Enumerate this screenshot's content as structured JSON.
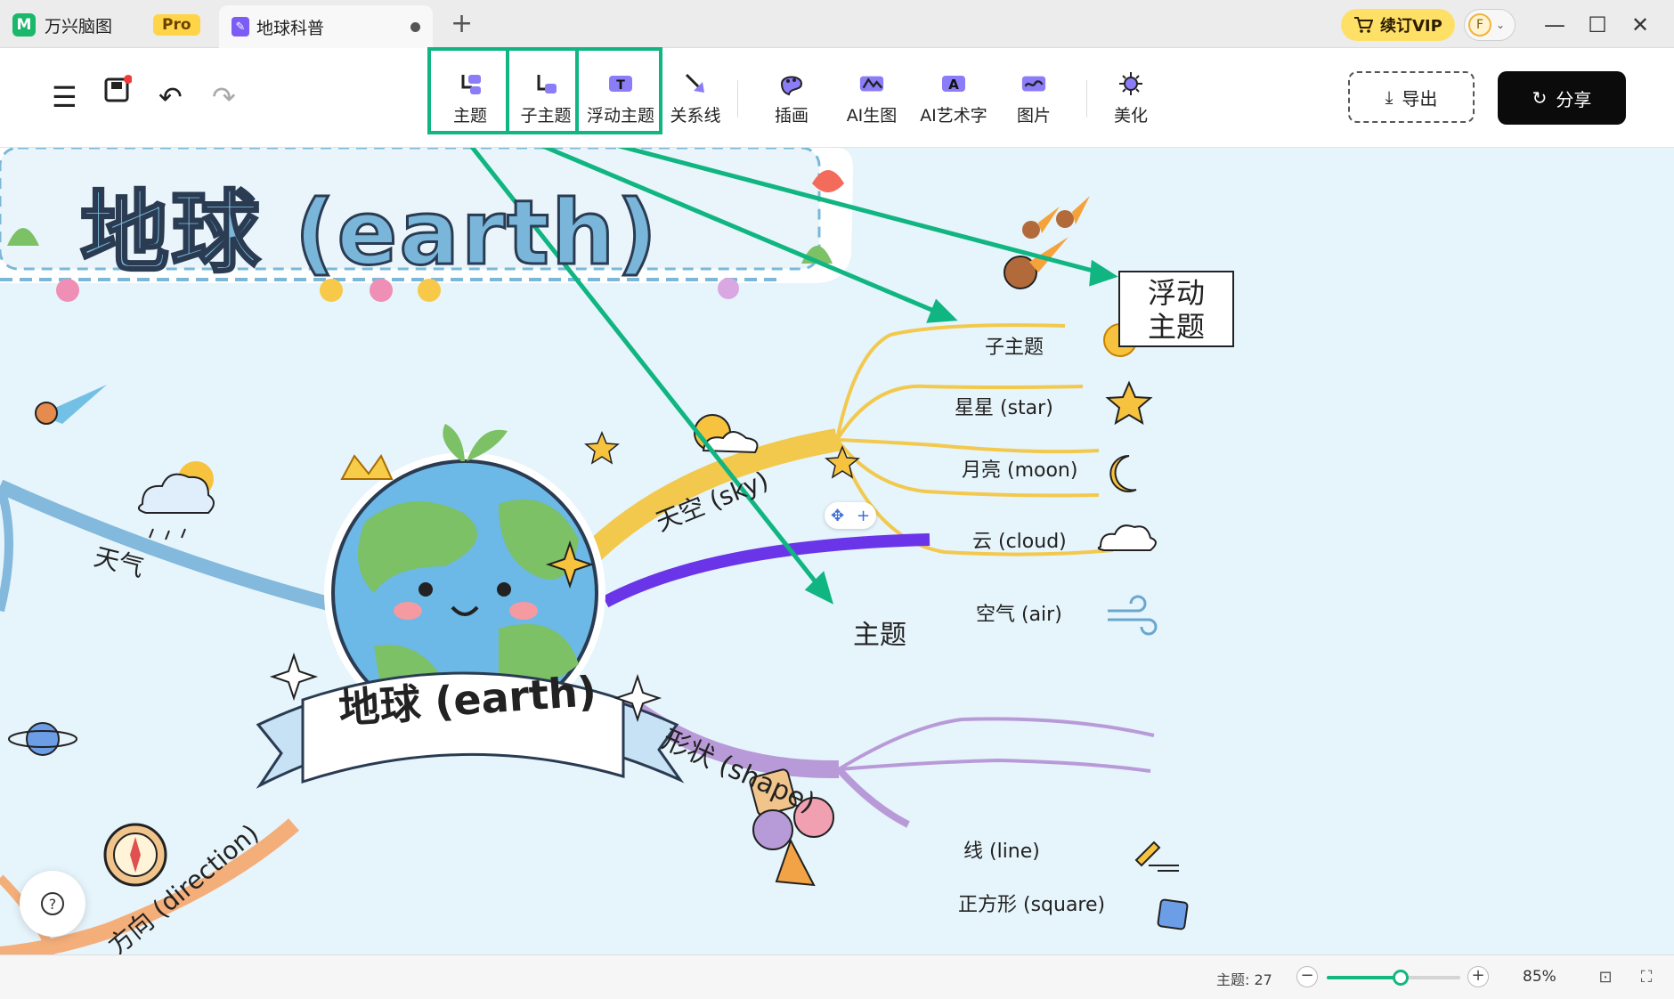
{
  "titlebar": {
    "app_name": "万兴脑图",
    "pro_badge": "Pro",
    "doc_tab": "地球科普",
    "vip_label": "续订VIP",
    "avatar_letter": "F",
    "new_tab": "+",
    "minimize": "—",
    "maximize": "☐",
    "close": "✕"
  },
  "toolbar": {
    "tools": [
      {
        "label": "主题",
        "icon": "topic-icon"
      },
      {
        "label": "子主题",
        "icon": "subtopic-icon"
      },
      {
        "label": "浮动主题",
        "icon": "floating-topic-icon"
      },
      {
        "label": "关系线",
        "icon": "relation-line-icon"
      },
      {
        "label": "插画",
        "icon": "illustration-icon"
      },
      {
        "label": "AI生图",
        "icon": "ai-image-icon"
      },
      {
        "label": "AI艺术字",
        "icon": "ai-art-text-icon"
      },
      {
        "label": "图片",
        "icon": "image-icon"
      },
      {
        "label": "美化",
        "icon": "beautify-icon"
      }
    ],
    "export_label": "导出",
    "share_label": "分享"
  },
  "canvas": {
    "banner_title": "地球 (earth)",
    "central_label": "地球 (earth)",
    "branches": {
      "sky": "天空 (sky)",
      "weather": "天气",
      "direction": "方向 (direction)",
      "shape": "形状 (shape)",
      "topic": "主题"
    },
    "sky_children": [
      "子主题",
      "星星 (star)",
      "月亮 (moon)",
      "云 (cloud)",
      "空气 (air)"
    ],
    "shape_children": [
      "线 (line)",
      "正方形 (square)"
    ],
    "floating_topic": [
      "浮动",
      "主题"
    ],
    "help": "?"
  },
  "statusbar": {
    "topic_count": "主题: 27",
    "zoom": "85%",
    "zoom_level": 0.55
  },
  "colors": {
    "highlight": "#10b581",
    "sky_branch": "#f2c94c",
    "weather_branch": "#82b9dc",
    "direction_branch": "#f4ae7a",
    "shape_branch": "#b99ad9",
    "topic_branch": "#6a35e8"
  }
}
